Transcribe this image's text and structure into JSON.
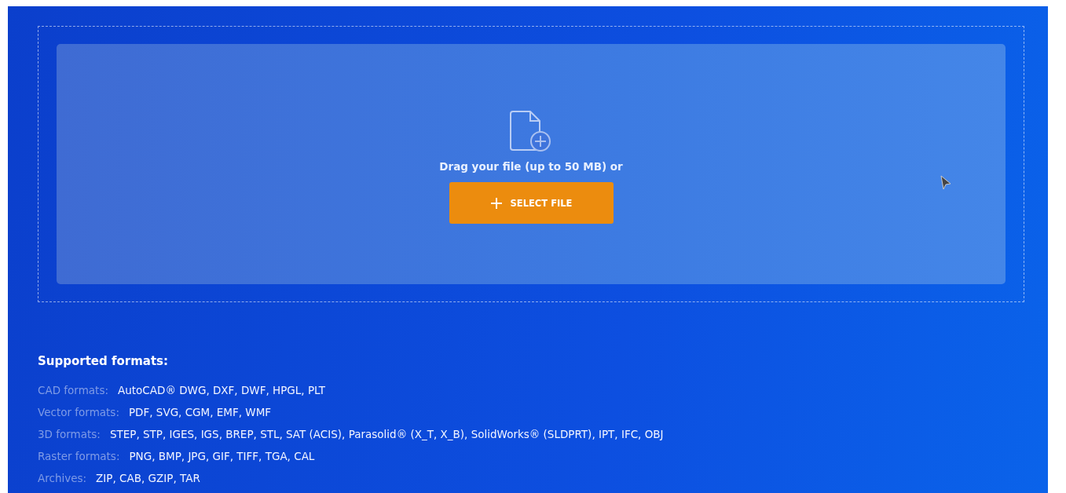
{
  "upload": {
    "prompt": "Drag your file (up to 50 MB) or",
    "button": "SELECT FILE"
  },
  "formats": {
    "title": "Supported formats:",
    "rows": [
      {
        "label": "CAD formats:",
        "value": "AutoCAD® DWG, DXF, DWF, HPGL, PLT"
      },
      {
        "label": "Vector formats:",
        "value": "PDF, SVG, CGM, EMF, WMF"
      },
      {
        "label": "3D formats:",
        "value": "STEP, STP, IGES, IGS, BREP, STL, SAT (ACIS), Parasolid® (X_T, X_B), SolidWorks® (SLDPRT), IPT, IFC, OBJ"
      },
      {
        "label": "Raster formats:",
        "value": "PNG, BMP, JPG, GIF, TIFF, TGA, CAL"
      },
      {
        "label": "Archives:",
        "value": "ZIP, CAB, GZIP, TAR"
      }
    ]
  }
}
